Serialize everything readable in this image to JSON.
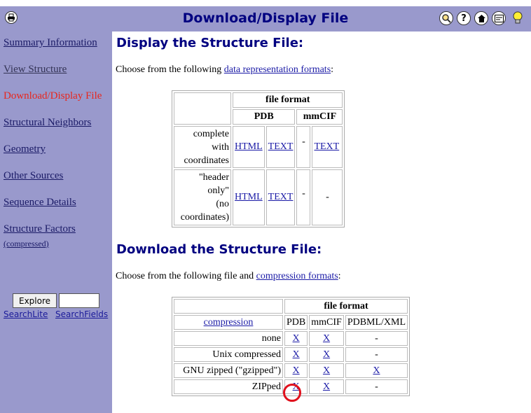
{
  "header": {
    "title": "Download/Display File",
    "icons": [
      "print-icon",
      "search-icon",
      "help-icon",
      "home-icon",
      "card-icon",
      "lightbulb-icon"
    ]
  },
  "sidebar": {
    "items": [
      {
        "label": "Summary Information",
        "state": "link"
      },
      {
        "label": "View Structure",
        "state": "visited"
      },
      {
        "label": "Download/Display File",
        "state": "current"
      },
      {
        "label": "Structural Neighbors",
        "state": "link"
      },
      {
        "label": "Geometry",
        "state": "link"
      },
      {
        "label": "Other Sources",
        "state": "link"
      },
      {
        "label": "Sequence Details",
        "state": "link"
      },
      {
        "label": "Structure Factors",
        "state": "link"
      }
    ],
    "structure_factors_sub": "(compressed)",
    "explore_button": "Explore",
    "search_value": "",
    "search_lite": "SearchLite",
    "search_fields": "SearchFields"
  },
  "display_section": {
    "heading": "Display the Structure File:",
    "intro_prefix": "Choose from the following ",
    "intro_link": "data representation formats",
    "intro_suffix": ":",
    "table": {
      "group_header": "file format",
      "col_pdb": "PDB",
      "col_mmcif": "mmCIF",
      "rows": [
        {
          "label_lines": [
            "complete",
            "with",
            "coordinates"
          ],
          "pdb_html": "HTML",
          "pdb_text": "TEXT",
          "mmcif_1": "-",
          "mmcif_2": "TEXT"
        },
        {
          "label_lines": [
            "\"header",
            "only\"",
            "(no",
            "coordinates)"
          ],
          "pdb_html": "HTML",
          "pdb_text": "TEXT",
          "mmcif_1": "-",
          "mmcif_2": "-"
        }
      ]
    }
  },
  "download_section": {
    "heading": "Download the Structure File:",
    "intro_prefix": "Choose from the following file and ",
    "intro_link": "compression formats",
    "intro_suffix": ":",
    "table": {
      "group_header": "file format",
      "compression_header": "compression",
      "col_pdb": "PDB",
      "col_mmcif": "mmCIF",
      "col_pdbml": "PDBML/XML",
      "rows": [
        {
          "label": "none",
          "pdb": "X",
          "mmcif": "X",
          "pdbml": "-"
        },
        {
          "label": "Unix compressed",
          "pdb": "X",
          "mmcif": "X",
          "pdbml": "-"
        },
        {
          "label": "GNU zipped (\"gzipped\")",
          "pdb": "X",
          "mmcif": "X",
          "pdbml": "X"
        },
        {
          "label": "ZIPped",
          "pdb": "X",
          "mmcif": "X",
          "pdbml": "-"
        }
      ]
    }
  },
  "colors": {
    "header_bg": "#9999cc",
    "title": "#000080",
    "current_nav": "#e8261c",
    "highlight": "#e0101c"
  }
}
